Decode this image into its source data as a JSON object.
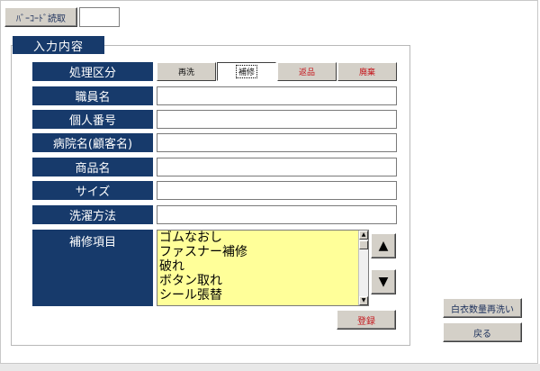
{
  "header": {
    "barcode_button": "ﾊﾞｰｺｰﾄﾞ読取"
  },
  "section": {
    "title": "入力内容"
  },
  "form": {
    "process_label": "処理区分",
    "process_options": [
      {
        "label": "再洗",
        "color": "#111111"
      },
      {
        "label": "補修",
        "color": "#111111"
      },
      {
        "label": "返品",
        "color": "#c4161c"
      },
      {
        "label": "廃棄",
        "color": "#c4161c"
      }
    ],
    "fields": [
      {
        "label": "職員名",
        "value": ""
      },
      {
        "label": "個人番号",
        "value": ""
      },
      {
        "label": "病院名(顧客名)",
        "value": ""
      },
      {
        "label": "商品名",
        "value": ""
      },
      {
        "label": "サイズ",
        "value": ""
      },
      {
        "label": "洗濯方法",
        "value": ""
      }
    ],
    "repair_label": "補修項目",
    "repair_items": [
      "ゴムなおし",
      "ファスナー補修",
      "破れ",
      "ボタン取れ",
      "シール張替"
    ],
    "up_icon": "▲",
    "down_icon": "▼",
    "submit_label": "登録"
  },
  "side": {
    "rewash_label": "白衣数量再洗い",
    "back_label": "戻る"
  },
  "colors": {
    "label_bg": "#173a6b",
    "list_bg": "#ffff99",
    "accent_red": "#c4161c"
  }
}
